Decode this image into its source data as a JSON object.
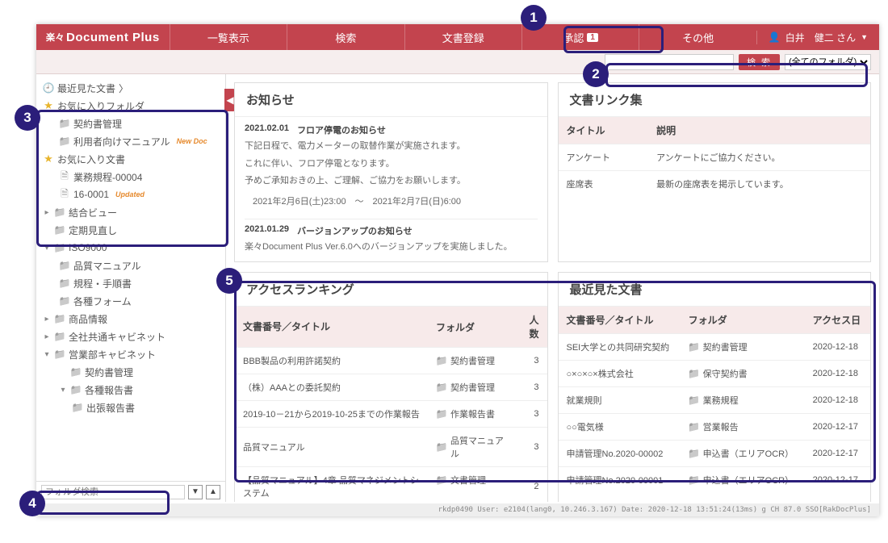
{
  "brand": {
    "prefix": "楽々",
    "name": "Document Plus"
  },
  "nav": {
    "list": "一覧表示",
    "search": "検索",
    "register": "文書登録",
    "approve": "承認",
    "approve_badge": "1",
    "other": "その他"
  },
  "user": {
    "icon": "👤",
    "name": "白井　健二 さん"
  },
  "searchbar": {
    "button": "検 索",
    "folder_sel": "(全てのフォルダ)"
  },
  "sidebar": {
    "recent": "最近見た文書",
    "fav_folder": "お気に入りフォルダ",
    "fav_folder_items": [
      "契約書管理",
      "利用者向けマニュアル"
    ],
    "fav_folder_newdoc": "New Doc",
    "fav_doc": "お気に入り文書",
    "fav_doc_items": [
      "業務規程-00004",
      "16-0001"
    ],
    "fav_doc_updated": "Updated",
    "tree": {
      "combined": "結合ビュー",
      "periodic": "定期見直し",
      "iso": "ISO9000",
      "iso_children": [
        "品質マニュアル",
        "規程・手順書",
        "各種フォーム"
      ],
      "product": "商品情報",
      "shared": "全社共通キャビネット",
      "sales": "営業部キャビネット",
      "sales_children": [
        "契約書管理",
        "各種報告書"
      ],
      "sales_sub": "出張報告書"
    },
    "folder_search_placeholder": "フォルダ検索"
  },
  "panels": {
    "notice_title": "お知らせ",
    "notice1": {
      "date": "2021.02.01",
      "title": "フロア停電のお知らせ",
      "lines": [
        "下記日程で、電力メーターの取替作業が実施されます。",
        "これに伴い、フロア停電となります。",
        "予めご承知おきの上、ご理解、ご協力をお願いします。"
      ],
      "schedule": "2021年2月6日(土)23:00　～　2021年2月7日(日)6:00"
    },
    "notice2": {
      "date": "2021.01.29",
      "title": "バージョンアップのお知らせ",
      "line": "楽々Document Plus Ver.6.0へのバージョンアップを実施しました。"
    },
    "links": {
      "title": "文書リンク集",
      "h_title": "タイトル",
      "h_desc": "説明",
      "rows": [
        {
          "t": "アンケート",
          "d": "アンケートにご協力ください。"
        },
        {
          "t": "座席表",
          "d": "最新の座席表を掲示しています。"
        }
      ]
    },
    "ranking": {
      "title": "アクセスランキング",
      "h1": "文書番号／タイトル",
      "h2": "フォルダ",
      "h3": "人数",
      "rows": [
        {
          "t": "BBB製品の利用許諾契約",
          "f": "契約書管理",
          "c": "3"
        },
        {
          "t": "（株）AAAとの委託契約",
          "f": "契約書管理",
          "c": "3"
        },
        {
          "t": "2019-10－21から2019-10-25までの作業報告",
          "f": "作業報告書",
          "c": "3"
        },
        {
          "t": "品質マニュアル",
          "f": "品質マニュアル",
          "c": "3"
        },
        {
          "t": "【品質マニュアル】4章 品質マネジメントシステム",
          "f": "文書管理",
          "c": "2"
        }
      ]
    },
    "recent": {
      "title": "最近見た文書",
      "h1": "文書番号／タイトル",
      "h2": "フォルダ",
      "h3": "アクセス日",
      "rows": [
        {
          "t": "SEI大学との共同研究契約",
          "f": "契約書管理",
          "d": "2020-12-18"
        },
        {
          "t": "○×○×○×株式会社",
          "f": "保守契約書",
          "d": "2020-12-18"
        },
        {
          "t": "就業規則",
          "f": "業務規程",
          "d": "2020-12-18"
        },
        {
          "t": "○○電気様",
          "f": "営業報告",
          "d": "2020-12-17"
        },
        {
          "t": "申請管理No.2020-00002",
          "f": "申込書（エリアOCR）",
          "d": "2020-12-17"
        },
        {
          "t": "申請管理No.2020-00001",
          "f": "申込書（エリアOCR）",
          "d": "2020-12-17"
        }
      ]
    }
  },
  "footer": "rkdp0490  User: e2104(lang0, 10.246.3.167)  Date: 2020-12-18 13:51:24(13ms) g CH 87.0  SSO[RakDocPlus]",
  "bubbles": {
    "1": "1",
    "2": "2",
    "3": "3",
    "4": "4",
    "5": "5"
  }
}
